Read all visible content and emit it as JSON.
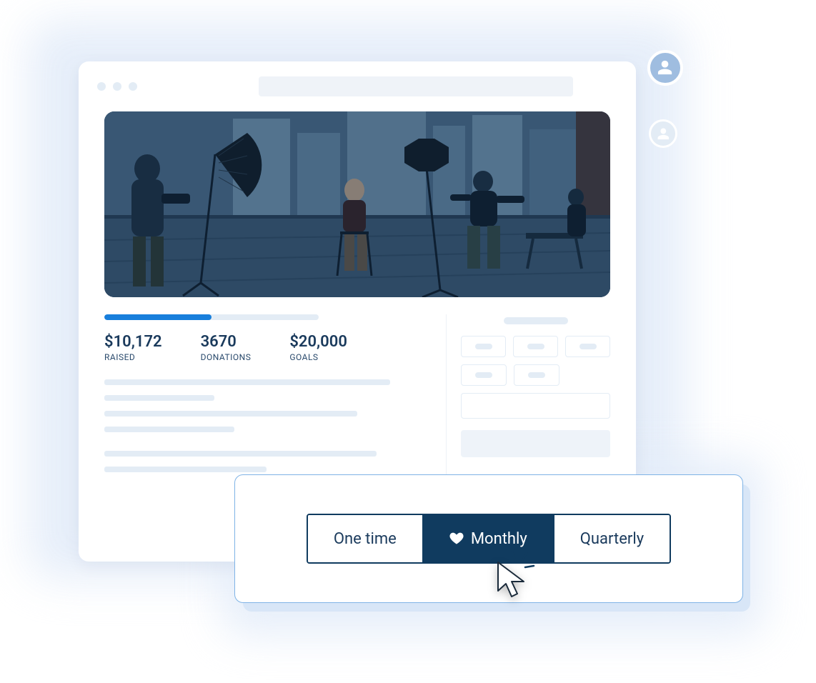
{
  "stats": {
    "raised": {
      "value": "$10,172",
      "label": "RAISED"
    },
    "donations": {
      "value": "3670",
      "label": "DONATIONS"
    },
    "goals": {
      "value": "$20,000",
      "label": "GOALS"
    }
  },
  "progress_percent": 50,
  "frequency": {
    "options": {
      "one_time": "One time",
      "monthly": "Monthly",
      "quarterly": "Quarterly"
    },
    "selected": "monthly"
  },
  "icons": {
    "heart": "heart-icon",
    "user": "user-icon",
    "cursor": "cursor-icon"
  },
  "colors": {
    "brand_dark": "#103b5f",
    "accent_blue": "#187fdc",
    "soft_bg": "#e3ecf5"
  }
}
